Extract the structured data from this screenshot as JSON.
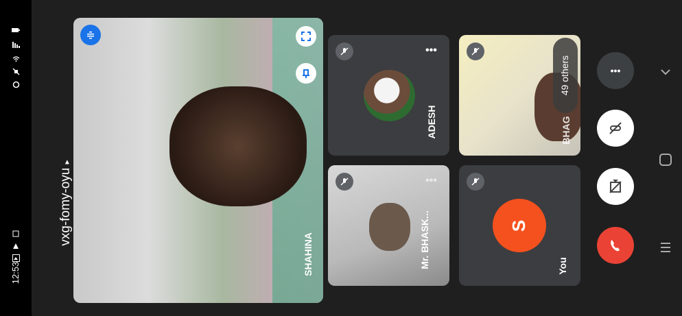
{
  "status_bar": {
    "time": "12:53",
    "icons": [
      "gallery-icon",
      "play-icon",
      "cast-icon",
      "alarm-icon",
      "wifi-icon",
      "signal-icon",
      "battery-icon"
    ]
  },
  "meeting": {
    "code": "vxg-fomy-oyu",
    "code_chevron": "▸"
  },
  "participants": {
    "main": {
      "name": "SHAHINA"
    },
    "tiles": [
      {
        "name": "ADESH",
        "menu": "•••"
      },
      {
        "name": "BHAG"
      },
      {
        "name": "Mr. BHASK...",
        "menu": "•••"
      },
      {
        "name": "You",
        "avatar_letter": "S"
      }
    ],
    "others": "49 others"
  },
  "controls": {
    "more": "•••"
  },
  "colors": {
    "end_call": "#ea4335",
    "you_avatar": "#f4511e",
    "accent_blue": "#1a73e8"
  }
}
